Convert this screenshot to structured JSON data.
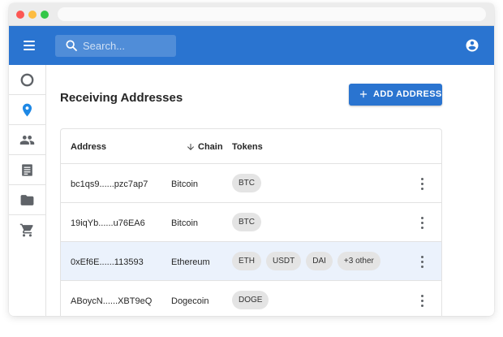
{
  "colors": {
    "accent": "#2a74d0",
    "selected_row": "#ebf2fc",
    "active_nav_icon": "#1e88e5",
    "chip_bg": "#e4e4e4"
  },
  "appbar": {
    "menu_icon": "menu-icon",
    "search_placeholder": "Search...",
    "account_icon": "account-circle-icon"
  },
  "sidebar": {
    "items": [
      {
        "icon": "circle-outline-icon",
        "active": false
      },
      {
        "icon": "location-pin-icon",
        "active": true
      },
      {
        "icon": "people-icon",
        "active": false
      },
      {
        "icon": "document-icon",
        "active": false
      },
      {
        "icon": "folder-icon",
        "active": false
      },
      {
        "icon": "cart-icon",
        "active": false
      }
    ]
  },
  "main": {
    "title": "Receiving Addresses",
    "add_button_label": "ADD ADDRESS"
  },
  "table": {
    "columns": {
      "address": "Address",
      "chain": "Chain",
      "tokens": "Tokens"
    },
    "sort": {
      "column": "chain",
      "direction": "descending"
    },
    "rows": [
      {
        "address": "bc1qs9......pzc7ap7",
        "chain": "Bitcoin",
        "tokens": [
          "BTC"
        ],
        "selected": false
      },
      {
        "address": "19iqYb......u76EA6",
        "chain": "Bitcoin",
        "tokens": [
          "BTC"
        ],
        "selected": false
      },
      {
        "address": "0xEf6E......113593",
        "chain": "Ethereum",
        "tokens": [
          "ETH",
          "USDT",
          "DAI",
          "+3 other"
        ],
        "selected": true
      },
      {
        "address": "ABoycN......XBT9eQ",
        "chain": "Dogecoin",
        "tokens": [
          "DOGE"
        ],
        "selected": false
      }
    ]
  }
}
